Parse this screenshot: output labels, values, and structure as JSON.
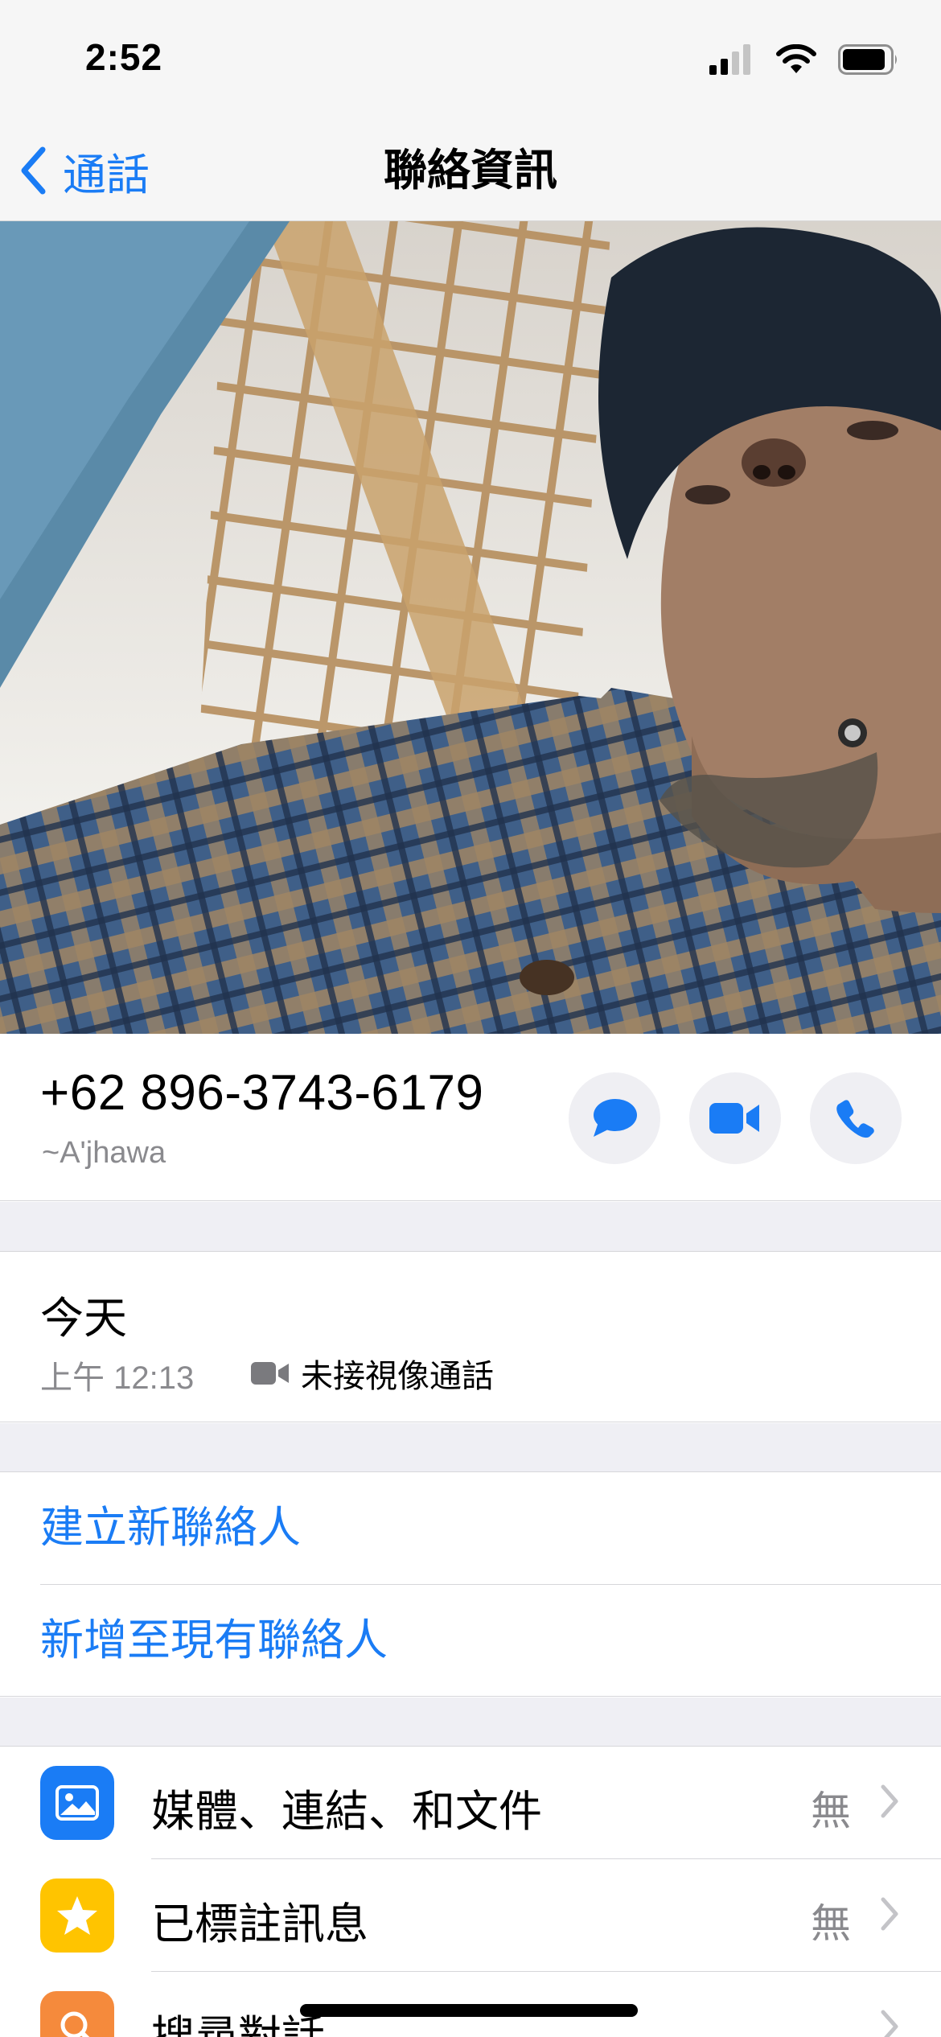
{
  "status_bar": {
    "time": "2:52",
    "signal": "cellular-signal-icon",
    "wifi": "wifi-icon",
    "battery": "battery-icon"
  },
  "nav": {
    "back_label": "通話",
    "title": "聯絡資訊"
  },
  "contact": {
    "number": "+62 896-3743-6179",
    "nickname": "~A'jhawa",
    "actions": [
      {
        "name": "message",
        "icon": "message-bubble-icon"
      },
      {
        "name": "video",
        "icon": "video-camera-icon"
      },
      {
        "name": "call",
        "icon": "phone-icon"
      }
    ]
  },
  "call_log": {
    "day": "今天",
    "time": "上午 12:13",
    "type_icon": "video-camera-icon",
    "type_label": "未接視像通話"
  },
  "contact_actions": {
    "create_new": "建立新聯絡人",
    "add_existing": "新增至現有聯絡人"
  },
  "settings": [
    {
      "label": "媒體、連結、和文件",
      "value": "無",
      "icon": "photo-icon",
      "icon_color": "#1a7cf5"
    },
    {
      "label": "已標註訊息",
      "value": "無",
      "icon": "star-icon",
      "icon_color": "#ffc400"
    },
    {
      "label": "搜尋對話",
      "value": "",
      "icon": "search-icon",
      "icon_color": "#f58a3c"
    }
  ],
  "colors": {
    "accent": "#1a7cf5",
    "secondary_text": "#8a8a8e",
    "group_background": "#efeff4"
  }
}
